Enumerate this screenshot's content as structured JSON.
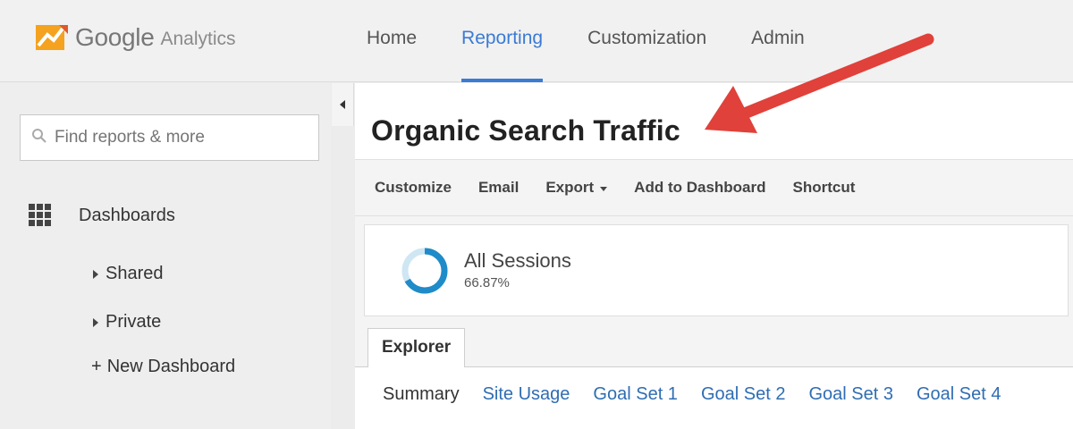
{
  "header": {
    "logo_word": "Google",
    "logo_sub": "Analytics",
    "nav": [
      {
        "label": "Home"
      },
      {
        "label": "Reporting"
      },
      {
        "label": "Customization"
      },
      {
        "label": "Admin"
      }
    ],
    "active_nav": "Reporting",
    "accent_color": "#3a7bd5"
  },
  "sidebar": {
    "search_placeholder": "Find reports & more",
    "dashboards_label": "Dashboards",
    "items": [
      {
        "label": "Shared"
      },
      {
        "label": "Private"
      },
      {
        "label": "New Dashboard"
      }
    ]
  },
  "main": {
    "page_title": "Organic Search Traffic",
    "toolbar": {
      "customize": "Customize",
      "email": "Email",
      "export": "Export",
      "add_to_dashboard": "Add to Dashboard",
      "shortcut": "Shortcut"
    },
    "segment": {
      "name": "All Sessions",
      "percent_label": "66.87%",
      "percent_value": 66.87,
      "color": "#1f8bc9"
    },
    "explorer_tab": "Explorer",
    "subtabs": [
      {
        "label": "Summary"
      },
      {
        "label": "Site Usage"
      },
      {
        "label": "Goal Set 1"
      },
      {
        "label": "Goal Set 2"
      },
      {
        "label": "Goal Set 3"
      },
      {
        "label": "Goal Set 4"
      }
    ],
    "current_subtab": "Summary"
  },
  "annotation": {
    "arrow_color": "#e0413a"
  }
}
